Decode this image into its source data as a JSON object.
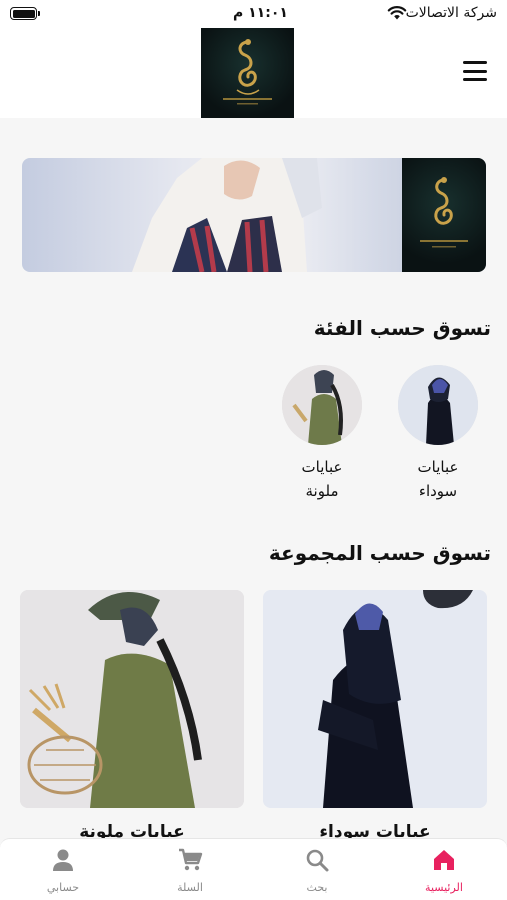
{
  "status_bar": {
    "carrier": "شركة الاتصالات",
    "time": "١١:٠١ م"
  },
  "header": {
    "logo_icon": "brand-logo",
    "menu_icon": "hamburger-menu-icon"
  },
  "banner": {
    "image": "hero-banner"
  },
  "categories": {
    "title": "تسوق حسب الفئة",
    "items": [
      {
        "label_line1": "عبايات",
        "label_line2": "سوداء"
      },
      {
        "label_line1": "عبايات",
        "label_line2": "ملونة"
      }
    ]
  },
  "collections": {
    "title": "تسوق حسب المجموعة",
    "items": [
      {
        "title": "عبايات سوداء"
      },
      {
        "title": "عبايات ملونة"
      }
    ]
  },
  "bottom_nav": {
    "items": [
      {
        "label": "الرئيسية",
        "icon": "home-icon",
        "active": true
      },
      {
        "label": "بحث",
        "icon": "search-icon",
        "active": false
      },
      {
        "label": "السلة",
        "icon": "cart-icon",
        "active": false
      },
      {
        "label": "حسابي",
        "icon": "user-icon",
        "active": false
      }
    ],
    "active_color": "#e8215f",
    "inactive_color": "#8a8a8a"
  }
}
